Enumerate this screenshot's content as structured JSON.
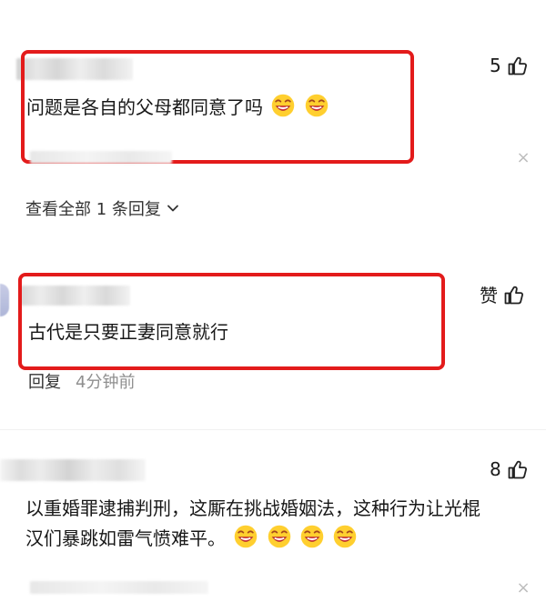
{
  "comments": [
    {
      "text": "问题是各自的父母都同意了吗",
      "likes": "5",
      "emoji_count": 2,
      "view_replies": "查看全部 1 条回复"
    },
    {
      "text": "古代是只要正妻同意就行",
      "likes": "赞",
      "reply_label": "回复",
      "time": "4分钟前"
    },
    {
      "text_line1": "以重婚罪逮捕判刑，这厮在挑战婚姻法，这种行为让光棍",
      "text_line2": "汉们暴跳如雷气愤难平。",
      "likes": "8",
      "emoji_count": 4
    }
  ],
  "colors": {
    "highlight": "#e31b1b",
    "text": "#171717",
    "muted": "#8f8f8f",
    "thumb": "#222222",
    "emoji_face": "#ffcf2f",
    "emoji_mouth": "#ff4b68"
  },
  "icons": {
    "like": "thumbs-up-icon",
    "close": "close-icon",
    "chevron": "chevron-down-icon",
    "emoji": "grinning-face-emoji-icon"
  }
}
